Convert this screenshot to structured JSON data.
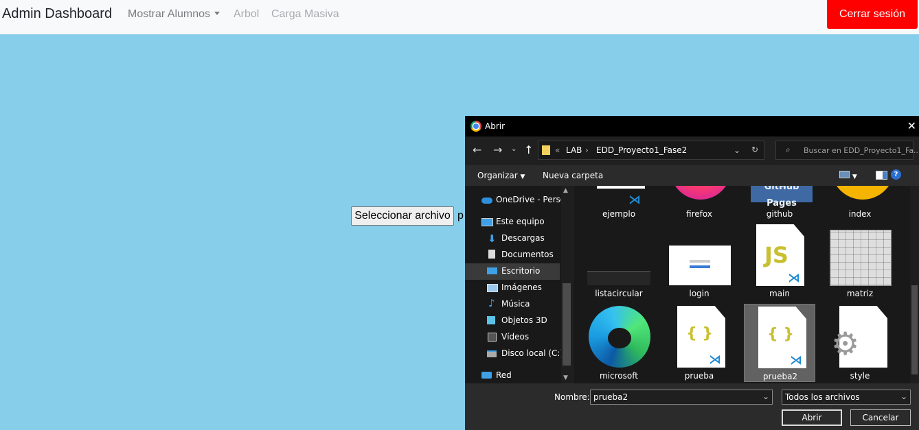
{
  "navbar": {
    "brand": "Admin Dashboard",
    "links": [
      "Mostrar Alumnos",
      "Arbol",
      "Carga Masiva"
    ],
    "logout": "Cerrar sesión"
  },
  "upload": {
    "button": "Seleccionar archivo",
    "trailing_text": "p"
  },
  "dialog": {
    "title": "Abrir",
    "breadcrumb": [
      "«",
      "LAB",
      "›",
      "EDD_Proyecto1_Fase2"
    ],
    "search_placeholder": "Buscar en EDD_Proyecto1_Fa...",
    "toolbar": {
      "organize": "Organizar",
      "new_folder": "Nueva carpeta"
    },
    "sidebar": [
      "OneDrive - Person",
      "Este equipo",
      "Descargas",
      "Documentos",
      "Escritorio",
      "Imágenes",
      "Música",
      "Objetos 3D",
      "Vídeos",
      "Disco local (C:)",
      "Red"
    ],
    "files": [
      "ejemplo",
      "firefox",
      "github",
      "index",
      "listacircular",
      "login",
      "main",
      "matriz",
      "microsoft",
      "prueba",
      "prueba2",
      "style"
    ],
    "github_text": "GitHub Pages",
    "js_text": "JS",
    "json_text": "{ }",
    "name_label": "Nombre:",
    "name_value": "prueba2",
    "filter": "Todos los archivos",
    "open": "Abrir",
    "cancel": "Cancelar",
    "help": "?"
  },
  "colors": {
    "page_bg": "#87ceeb",
    "logout_bg": "#ff0000",
    "dialog_bg": "#202020"
  }
}
